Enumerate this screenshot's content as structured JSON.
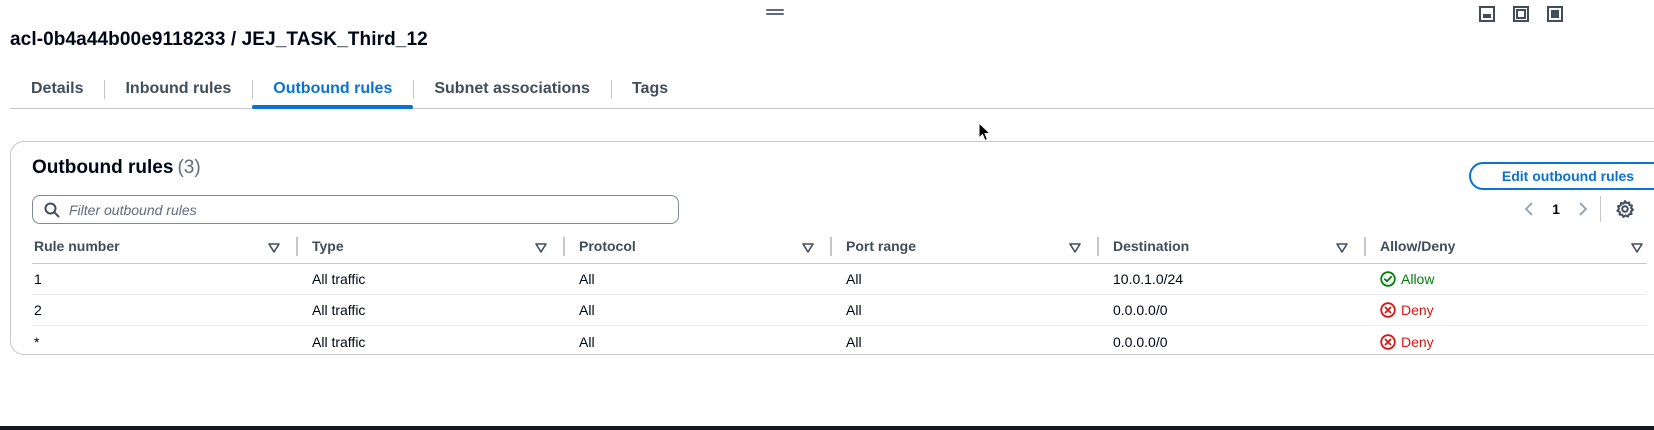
{
  "header": {
    "title": "acl-0b4a44b00e9118233 / JEJ_TASK_Third_12"
  },
  "tabs": [
    {
      "label": "Details",
      "active": false
    },
    {
      "label": "Inbound rules",
      "active": false
    },
    {
      "label": "Outbound rules",
      "active": true
    },
    {
      "label": "Subnet associations",
      "active": false
    },
    {
      "label": "Tags",
      "active": false
    }
  ],
  "panel": {
    "title": "Outbound rules",
    "count": "(3)",
    "edit_button": "Edit outbound rules",
    "filter_placeholder": "Filter outbound rules",
    "page": "1"
  },
  "table": {
    "columns": [
      "Rule number",
      "Type",
      "Protocol",
      "Port range",
      "Destination",
      "Allow/Deny"
    ],
    "rows": [
      {
        "rule_number": "1",
        "type": "All traffic",
        "protocol": "All",
        "port_range": "All",
        "destination": "10.0.1.0/24",
        "action": "Allow"
      },
      {
        "rule_number": "2",
        "type": "All traffic",
        "protocol": "All",
        "port_range": "All",
        "destination": "0.0.0.0/0",
        "action": "Deny"
      },
      {
        "rule_number": "*",
        "type": "All traffic",
        "protocol": "All",
        "port_range": "All",
        "destination": "0.0.0.0/0",
        "action": "Deny"
      }
    ]
  },
  "icons": {
    "drag": "drag-handle-icon",
    "layouts": [
      "panel-bottom-icon",
      "panel-side-icon",
      "panel-full-icon"
    ],
    "search": "search-icon",
    "prev": "chevron-left-icon",
    "next": "chevron-right-icon",
    "settings": "gear-icon",
    "sort": "sort-icon",
    "allow": "check-circle-icon",
    "deny": "x-circle-icon"
  },
  "colors": {
    "accent": "#0972d3",
    "allow": "#037f0c",
    "deny": "#d91515",
    "text": "#000716"
  }
}
